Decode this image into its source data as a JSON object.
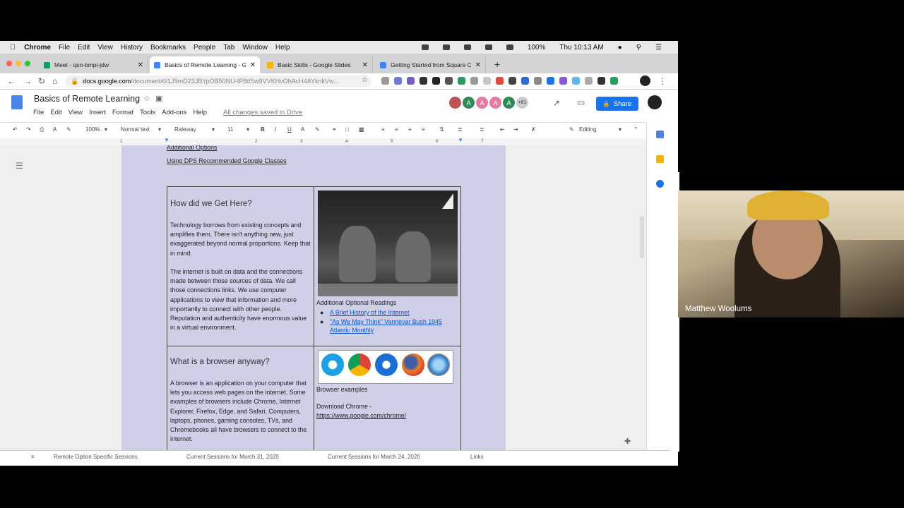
{
  "mac_menu": {
    "app": "Chrome",
    "items": [
      "File",
      "Edit",
      "View",
      "History",
      "Bookmarks",
      "People",
      "Tab",
      "Window",
      "Help"
    ],
    "battery": "100%",
    "clock": "Thu 10:13 AM"
  },
  "tabs": [
    {
      "label": "Meet - qsn-bmpi-jdw",
      "color": "#0f9d58",
      "active": false
    },
    {
      "label": "Basics of Remote Learning - Go",
      "color": "#4285f4",
      "active": true
    },
    {
      "label": "Basic Skills - Google Slides",
      "color": "#f4b400",
      "active": false
    },
    {
      "label": "Getting Started from Square One",
      "color": "#4285f4",
      "active": false
    }
  ],
  "address": {
    "host": "docs.google.com",
    "path": "/document/d/1J9mD23JBYpOB50NU-IP8dSw9VVKHvOhAcH4AYknkVw..."
  },
  "doc": {
    "title": "Basics of Remote Learning",
    "menus": [
      "File",
      "Edit",
      "View",
      "Insert",
      "Format",
      "Tools",
      "Add-ons",
      "Help"
    ],
    "saved_status": "All changes saved in Drive",
    "avatar_more": "+61",
    "share_label": "Share"
  },
  "toolbar": {
    "zoom": "100%",
    "style": "Normal text",
    "font": "Raleway",
    "size": "11",
    "mode": "Editing"
  },
  "ruler_marks": [
    "1",
    "2",
    "3",
    "4",
    "5",
    "6",
    "7"
  ],
  "content": {
    "top_links": [
      "Additional Options",
      "Using DPS Recommended Google Classes"
    ],
    "section1": {
      "heading": "How did we Get Here?",
      "para1": "Technology borrows from existing concepts and amplifies them. There isn't anything new, just exaggerated beyond normal proportions. Keep that in mind.",
      "para2": "The internet is built on data and the connections made between those sources of data. We call those connections links. We use computer applications to view that information and more importantly to connect with other people. Reputation and authenticity have enormous value in a virtual environment.",
      "readings_label": "Additional Optional Readings",
      "readings": [
        "A Brief History of the Internet",
        "\"As We May Think\" Vannevar Bush 1945 Atlantic Monthly"
      ]
    },
    "section2": {
      "heading": "What is a browser anyway?",
      "para": "A browser is an application on your computer that lets you access web pages on the internet. Some examples of browsers include Chrome, Internet Explorer, Firefox, Edge, and Safari. Computers, laptops, phones, gaming consoles, TVs, and Chromebooks all have browsers to connect to the internet.",
      "caption": "Browser examples",
      "download_label": "Download Chrome -",
      "download_link": "https://www.google.com/chrome/"
    }
  },
  "bottom_tabs": [
    "Remote Option Specific Sessions",
    "Current Sessions for March 31, 2020",
    "Current Sessions for March 24, 2020",
    "Links"
  ],
  "video": {
    "participant": "Matthew Woolums"
  }
}
